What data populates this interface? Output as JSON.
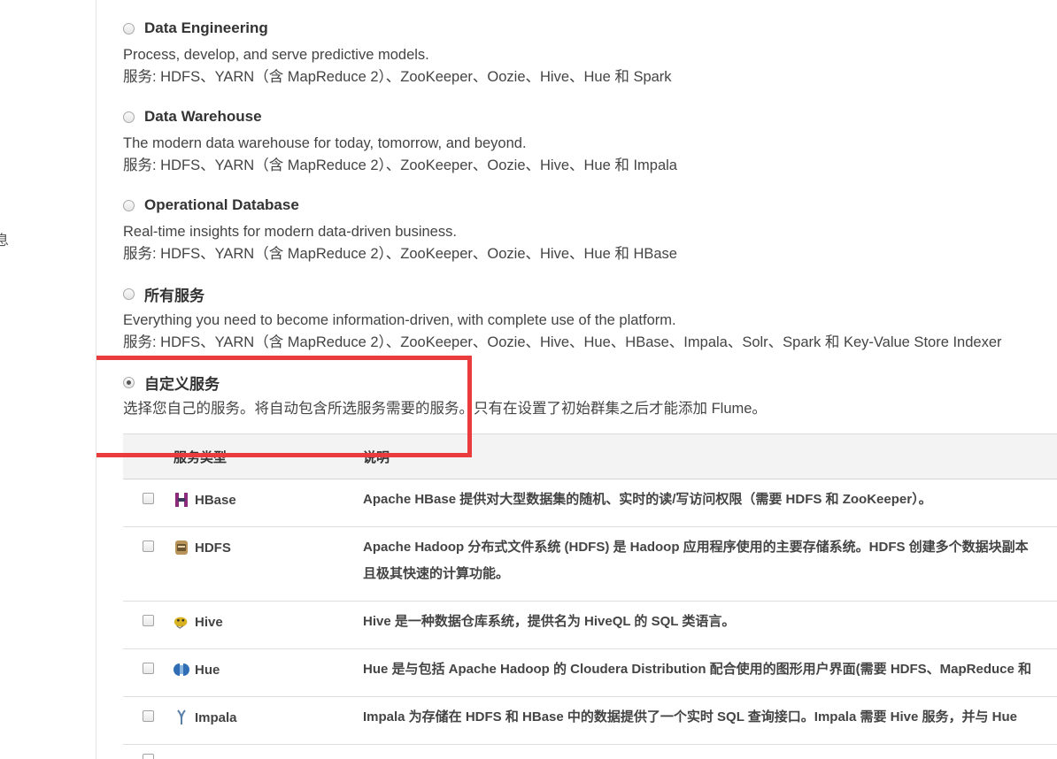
{
  "sidebar": {
    "fragment": "息"
  },
  "options": [
    {
      "title": "Data Engineering",
      "description": "Process, develop, and serve predictive models.",
      "services": "服务: HDFS、YARN（含 MapReduce 2）、ZooKeeper、Oozie、Hive、Hue 和 Spark",
      "checked": false
    },
    {
      "title": "Data Warehouse",
      "description": "The modern data warehouse for today, tomorrow, and beyond.",
      "services": "服务: HDFS、YARN（含 MapReduce 2）、ZooKeeper、Oozie、Hive、Hue 和 Impala",
      "checked": false
    },
    {
      "title": "Operational Database",
      "description": "Real-time insights for modern data-driven business.",
      "services": "服务: HDFS、YARN（含 MapReduce 2）、ZooKeeper、Oozie、Hive、Hue 和 HBase",
      "checked": false
    },
    {
      "title": "所有服务",
      "description": "Everything you need to become information-driven, with complete use of the platform.",
      "services": "服务: HDFS、YARN（含 MapReduce 2）、ZooKeeper、Oozie、Hive、Hue、HBase、Impala、Solr、Spark 和 Key-Value Store Indexer",
      "checked": false
    },
    {
      "title": "自定义服务",
      "description": "选择您自己的服务。将自动包含所选服务需要的服务。只有在设置了初始群集之后才能添加 Flume。",
      "checked": true
    }
  ],
  "table": {
    "headers": {
      "service_type": "服务类型",
      "description": "说明"
    },
    "rows": [
      {
        "name": "HBase",
        "icon": "hbase-icon",
        "description": [
          "Apache HBase 提供对大型数据集的随机、实时的读/写访问权限（需要 HDFS 和 ZooKeeper）。"
        ]
      },
      {
        "name": "HDFS",
        "icon": "hdfs-icon",
        "description": [
          "Apache Hadoop 分布式文件系统 (HDFS) 是 Hadoop 应用程序使用的主要存储系统。HDFS 创建多个数据块副本",
          "且极其快速的计算功能。"
        ]
      },
      {
        "name": "Hive",
        "icon": "hive-icon",
        "description": [
          "Hive 是一种数据仓库系统，提供名为 HiveQL 的 SQL 类语言。"
        ]
      },
      {
        "name": "Hue",
        "icon": "hue-icon",
        "description": [
          "Hue 是与包括 Apache Hadoop 的 Cloudera Distribution 配合使用的图形用户界面(需要 HDFS、MapReduce 和"
        ]
      },
      {
        "name": "Impala",
        "icon": "impala-icon",
        "description": [
          "Impala 为存储在 HDFS 和 HBase 中的数据提供了一个实时 SQL 查询接口。Impala 需要 Hive 服务，并与 Hue"
        ]
      }
    ]
  },
  "colors": {
    "highlight": "#ea3c3c",
    "hbase": "#8a2a7a",
    "hdfs": "#b8935a",
    "hive": "#d9b31f",
    "hue": "#2f6db5",
    "impala": "#5a7fa8"
  }
}
